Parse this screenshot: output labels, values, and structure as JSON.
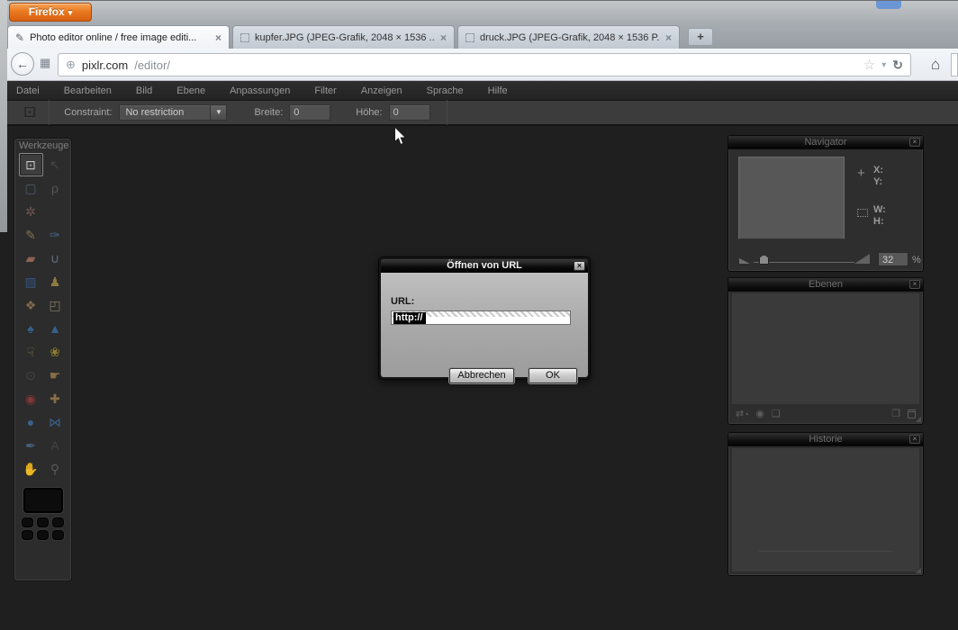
{
  "icons": {
    "close": "×",
    "pencil": "✎",
    "back": "←",
    "library": "▦",
    "globe": "⊕",
    "star": "☆",
    "caret": "▾",
    "dropdown": "▼",
    "reload": "↻",
    "home": "⌂",
    "new_tab": "+",
    "firefox_caret": "▾",
    "crop_option": "⊡",
    "nav_cross": "+",
    "layer_swap": "⇄",
    "layer_swap_arrow": "▴",
    "layer_mask": "◉",
    "layer_styles": "❏",
    "layer_new": "❐",
    "grip": "◢"
  },
  "colors": {
    "firefox_orange": "#ea7a20",
    "toolbar_dark": "#3c3c3c",
    "editor_bg": "#1f1f1f",
    "dialog_title_bg": "#000000",
    "accent_blue": "#3a6795"
  },
  "browser": {
    "firefox_button_label": "Firefox",
    "tabs": [
      {
        "title": "Photo editor online / free image editi..."
      },
      {
        "title": "kupfer.JPG (JPEG-Grafik, 2048 × 1536 ..."
      },
      {
        "title": "druck.JPG (JPEG-Grafik, 2048 × 1536 P..."
      }
    ],
    "url_domain": "pixlr.com",
    "url_path": "/editor/"
  },
  "menu_bar": {
    "items": [
      "Datei",
      "Bearbeiten",
      "Bild",
      "Ebene",
      "Anpassungen",
      "Filter",
      "Anzeigen",
      "Sprache",
      "Hilfe"
    ]
  },
  "options_bar": {
    "constraint_label": "Constraint:",
    "constraint_value": "No restriction",
    "width_label": "Breite:",
    "width_value": "0",
    "height_label": "Höhe:",
    "height_value": "0"
  },
  "tools_panel": {
    "title": "Werkzeuge",
    "tools": [
      {
        "name": "crop-tool",
        "glyph": "⊡",
        "color": "#d6d6d6",
        "selected": true
      },
      {
        "name": "move-tool",
        "glyph": "↖",
        "color": "#4a4a4a"
      },
      {
        "name": "marquee-tool",
        "glyph": "▢",
        "color": "#50607a"
      },
      {
        "name": "lasso-tool",
        "glyph": "ρ",
        "color": "#5a5a5a"
      },
      {
        "name": "wand-tool",
        "glyph": "✲",
        "color": "#7a5a5a"
      },
      {
        "name": "tool-gap",
        "glyph": ""
      },
      {
        "name": "pencil-tool",
        "glyph": "✎",
        "color": "#8a7a55"
      },
      {
        "name": "brush-tool",
        "glyph": "✑",
        "color": "#4a6a95"
      },
      {
        "name": "eraser-tool",
        "glyph": "▰",
        "color": "#9a6a5a"
      },
      {
        "name": "bucket-tool",
        "glyph": "∪",
        "color": "#6a7585"
      },
      {
        "name": "gradient-tool",
        "glyph": "▨",
        "color": "#35598c"
      },
      {
        "name": "clone-stamp-tool",
        "glyph": "♟",
        "color": "#9a8445"
      },
      {
        "name": "color-replace-tool",
        "glyph": "❖",
        "color": "#8a7050"
      },
      {
        "name": "draw-tool",
        "glyph": "◰",
        "color": "#8a8468"
      },
      {
        "name": "blur-tool",
        "glyph": "♠",
        "color": "#3a6795"
      },
      {
        "name": "sharpen-tool",
        "glyph": "▲",
        "color": "#3a6795"
      },
      {
        "name": "smudge-tool",
        "glyph": "☟",
        "color": "#93764a"
      },
      {
        "name": "sponge-tool",
        "glyph": "❀",
        "color": "#9a8430"
      },
      {
        "name": "dodge-tool",
        "glyph": "⊙",
        "color": "#474747"
      },
      {
        "name": "burn-tool",
        "glyph": "☛",
        "color": "#93764a"
      },
      {
        "name": "red-eye-tool",
        "glyph": "◉",
        "color": "#8a3a3a"
      },
      {
        "name": "heal-tool",
        "glyph": "✚",
        "color": "#93764a"
      },
      {
        "name": "bloat-tool",
        "glyph": "●",
        "color": "#3a6795"
      },
      {
        "name": "pinch-tool",
        "glyph": "⋈",
        "color": "#3a6795"
      },
      {
        "name": "colorpicker-tool",
        "glyph": "✒",
        "color": "#4a6a8a"
      },
      {
        "name": "type-tool",
        "glyph": "A",
        "color": "#454545"
      },
      {
        "name": "hand-tool",
        "glyph": "✋",
        "color": "#93702f"
      },
      {
        "name": "zoom-tool",
        "glyph": "⚲",
        "color": "#5f5f5f"
      }
    ]
  },
  "dialog": {
    "title": "Öffnen von URL",
    "url_label": "URL:",
    "url_value": "http://",
    "cancel_label": "Abbrechen",
    "ok_label": "OK"
  },
  "panels": {
    "navigator": {
      "title": "Navigator",
      "x_label": "X:",
      "y_label": "Y:",
      "w_label": "W:",
      "h_label": "H:",
      "zoom_value": "32",
      "percent": "%"
    },
    "layers": {
      "title": "Ebenen"
    },
    "history": {
      "title": "Historie"
    }
  }
}
